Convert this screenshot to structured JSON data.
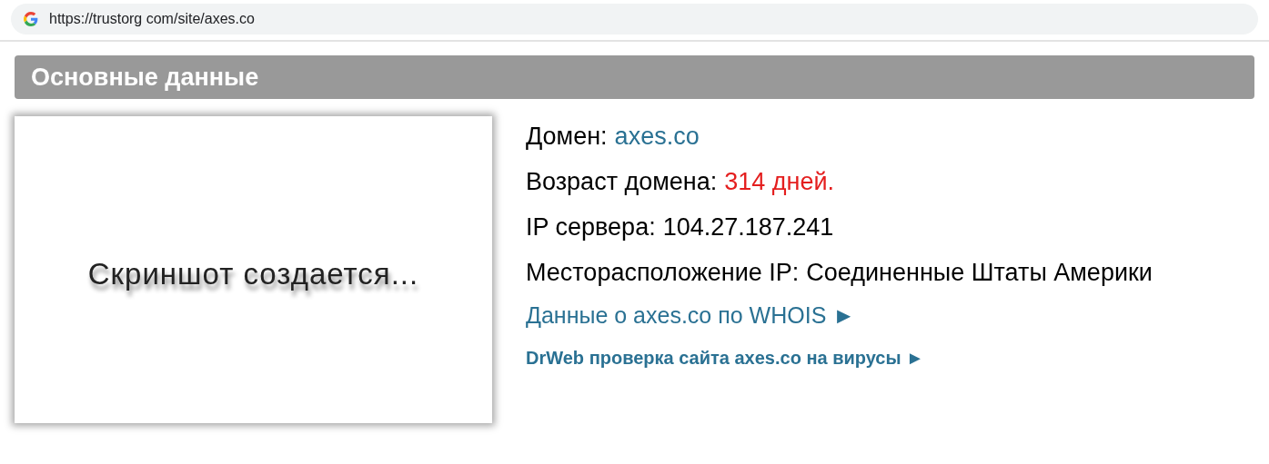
{
  "address_bar": {
    "url": "https://trustorg com/site/axes.co"
  },
  "section": {
    "title": "Основные данные"
  },
  "screenshot_placeholder": {
    "text": "Скриншот создается..."
  },
  "info": [
    {
      "label": "Домен:",
      "value": "axes.co",
      "kind": "link"
    },
    {
      "label": "Возраст домена:",
      "value": "314 дней.",
      "kind": "warning"
    },
    {
      "label": "IP сервера:",
      "value": "104.27.187.241",
      "kind": "plain"
    },
    {
      "label": "Месторасположение IP:",
      "value": "Соединенные Штаты Америки",
      "kind": "plain"
    }
  ],
  "links": [
    {
      "text": "Данные о axes.co по WHOIS ►",
      "kind": "large"
    },
    {
      "text": "DrWeb проверка сайта axes.co на вирусы ►",
      "kind": "small"
    }
  ]
}
